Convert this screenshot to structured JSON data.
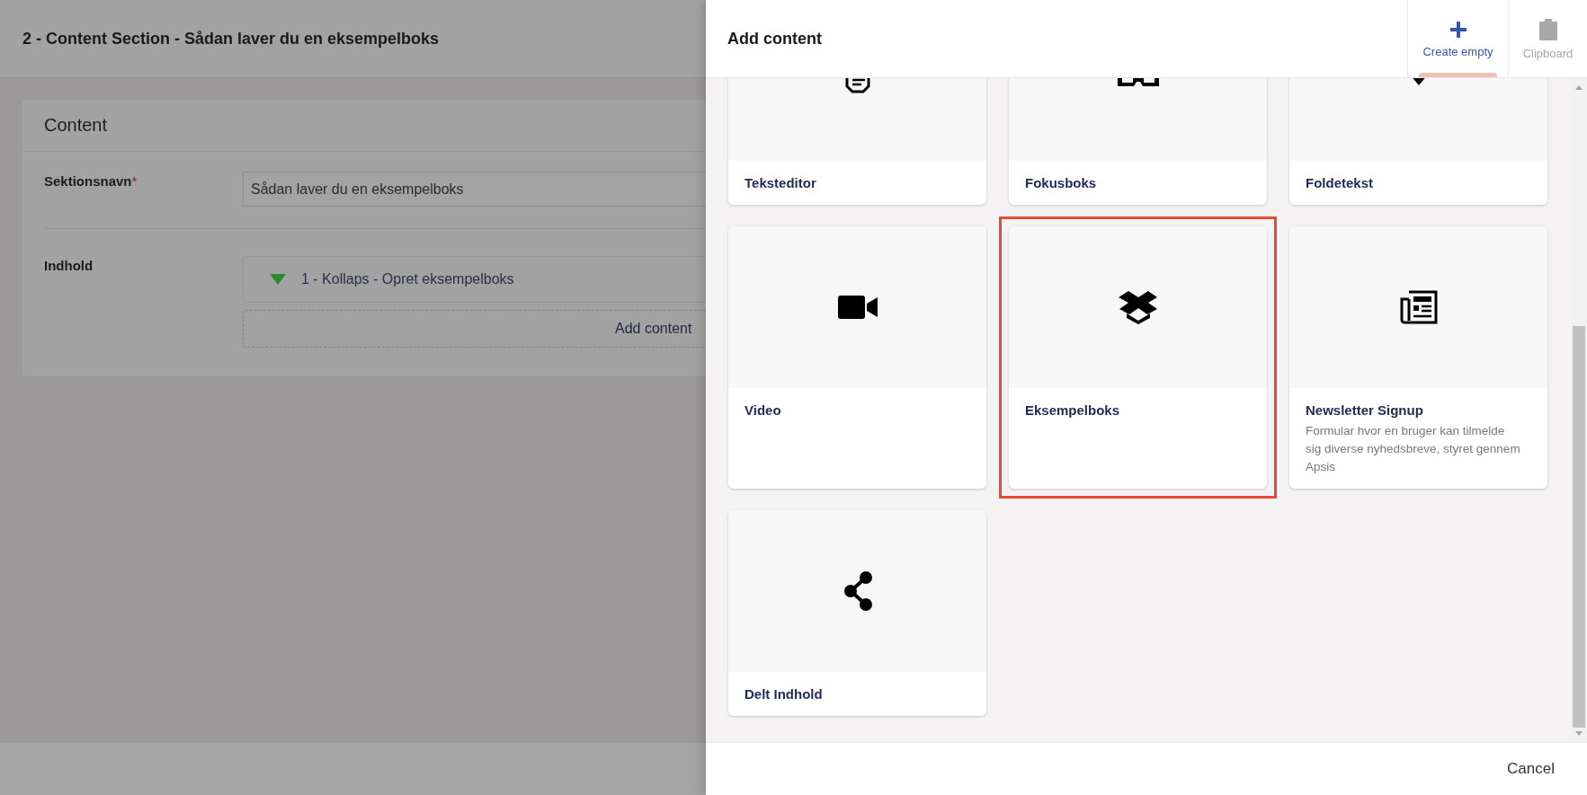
{
  "page": {
    "title": "2 - Content Section - Sådan laver du en eksempelboks",
    "panel": {
      "title": "Content",
      "fields": [
        {
          "kind": "text",
          "label": "Sektionsnavn",
          "required_mark": "*",
          "value": "Sådan laver du en eksempelboks"
        },
        {
          "kind": "blocks",
          "label": "Indhold",
          "items": [
            {
              "label": "1 - Kollaps - Opret eksempelboks",
              "expanded": true
            }
          ],
          "add_label": "Add content"
        }
      ]
    }
  },
  "dialog": {
    "title": "Add content",
    "actions": [
      {
        "kind": "plus",
        "label": "Create empty",
        "selected": true,
        "disabled": false
      },
      {
        "kind": "clipboard",
        "label": "Clipboard",
        "selected": false,
        "disabled": true
      }
    ],
    "cards": [
      {
        "kind": "document",
        "name": "Teksteditor",
        "selected": false
      },
      {
        "kind": "glasses",
        "name": "Fokusboks",
        "selected": false
      },
      {
        "kind": "triangle",
        "name": "Foldetekst",
        "selected": false
      },
      {
        "kind": "video",
        "name": "Video",
        "selected": false
      },
      {
        "kind": "box",
        "name": "Eksempelboks",
        "selected": true
      },
      {
        "kind": "newspaper",
        "name": "Newsletter Signup",
        "description": "Formular hvor en bruger kan tilmelde sig diverse nyhedsbreve, styret gennem Apsis",
        "selected": false
      },
      {
        "kind": "share",
        "name": "Delt Indhold",
        "selected": false
      }
    ],
    "cancel": "Cancel"
  }
}
